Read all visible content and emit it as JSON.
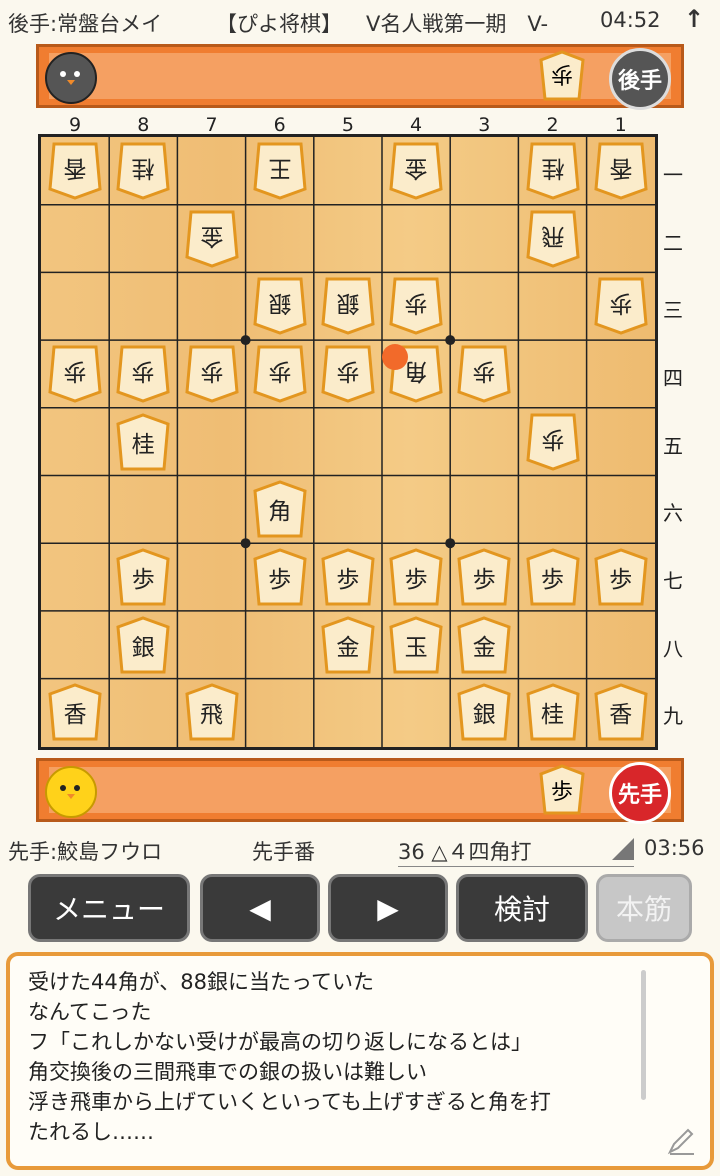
{
  "topbar": {
    "gote_player": "後手:常盤台メイ",
    "app_name": "【ぴよ将棋】",
    "event": "V名人戦第一期　V-",
    "clock": "04:52",
    "arrow": "↑"
  },
  "gote_hand": {
    "badge": "後手",
    "pieces": [
      "歩"
    ]
  },
  "sente_hand": {
    "badge": "先手",
    "pieces": [
      "歩"
    ]
  },
  "files": [
    "9",
    "8",
    "7",
    "6",
    "5",
    "4",
    "3",
    "2",
    "1"
  ],
  "ranks": [
    "一",
    "二",
    "三",
    "四",
    "五",
    "六",
    "七",
    "八",
    "九"
  ],
  "board": [
    [
      "香g",
      "桂g",
      "",
      "王g",
      "",
      "玉g",
      "",
      "桂g",
      "香g"
    ],
    [
      "",
      "",
      "金g",
      "",
      "",
      "",
      "",
      "飛g",
      ""
    ],
    [
      "",
      "",
      "",
      "銀g",
      "銀g",
      "歩g",
      "",
      "",
      "歩g"
    ],
    [
      "歩g",
      "歩g",
      "歩g",
      "歩g",
      "歩g",
      "角g",
      "歩g",
      "",
      ""
    ],
    [
      "",
      "桂s",
      "",
      "",
      "",
      "",
      "",
      "歩g",
      ""
    ],
    [
      "",
      "",
      "",
      "角s",
      "",
      "",
      "",
      "",
      ""
    ],
    [
      "",
      "歩s",
      "",
      "歩s",
      "歩s",
      "歩s",
      "歩s",
      "歩s",
      "歩s"
    ],
    [
      "",
      "銀s",
      "",
      "",
      "金s",
      "玉s",
      "金s",
      "",
      ""
    ],
    [
      "香s",
      "",
      "飛s",
      "",
      "",
      "",
      "銀s",
      "桂s",
      "香s"
    ]
  ],
  "board_labels": {
    "香g": "香",
    "桂g": "桂",
    "王g": "王",
    "玉g": "金",
    "金g": "金",
    "飛g": "飛",
    "銀g": "銀",
    "歩g": "歩",
    "角g": "角",
    "香s": "香",
    "桂s": "桂",
    "角s": "角",
    "歩s": "歩",
    "銀s": "銀",
    "金s": "金",
    "玉s": "玉",
    "飛s": "飛"
  },
  "status": {
    "sente_player": "先手:鮫島フウロ",
    "turn": "先手番",
    "move": "36 △４四角打",
    "clock": "03:56"
  },
  "buttons": {
    "menu": "メニュー",
    "prev": "◀",
    "next": "▶",
    "analyze": "検討",
    "mainline": "本筋"
  },
  "comment": {
    "lines": [
      "受けた44角が、88銀に当たっていた",
      "なんてこった",
      "フ「これしかない受けが最高の切り返しになるとは」",
      "角交換後の三間飛車での銀の扱いは難しい",
      "浮き飛車から上げていくといっても上げすぎると角を打",
      "たれるし……"
    ]
  },
  "colors": {
    "accent": "#f07d30",
    "marker": "#f26a2a"
  }
}
